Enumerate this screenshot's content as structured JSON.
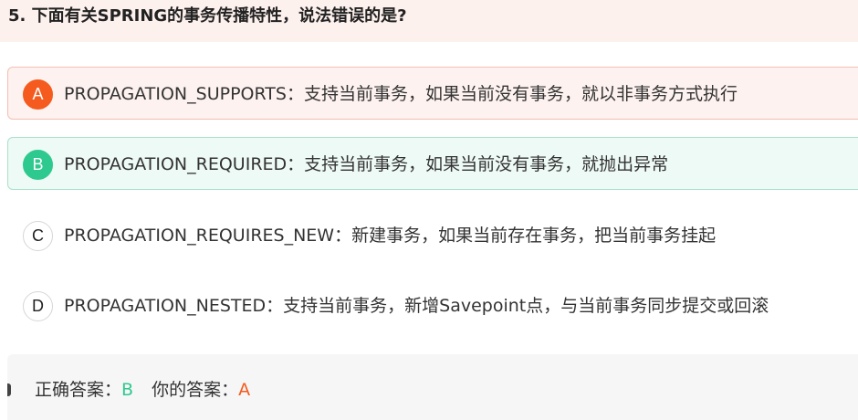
{
  "question": {
    "title": "5. 下面有关SPRING的事务传播特性，说法错误的是?"
  },
  "options": [
    {
      "letter": "A",
      "text": "PROPAGATION_SUPPORTS：支持当前事务，如果当前没有事务，就以非事务方式执行",
      "state": "selected-wrong",
      "color": "#f55a1e"
    },
    {
      "letter": "B",
      "text": "PROPAGATION_REQUIRED：支持当前事务，如果当前没有事务，就抛出异常",
      "state": "correct",
      "color": "#2ec98f"
    },
    {
      "letter": "C",
      "text": "PROPAGATION_REQUIRES_NEW：新建事务，如果当前存在事务，把当前事务挂起",
      "state": "unselected"
    },
    {
      "letter": "D",
      "text": "PROPAGATION_NESTED：支持当前事务，新增Savepoint点，与当前事务同步提交或回滚",
      "state": "unselected"
    }
  ],
  "answer": {
    "correct_label": "正确答案：",
    "correct_value": "B",
    "yours_label": "你的答案：",
    "yours_value": "A"
  }
}
